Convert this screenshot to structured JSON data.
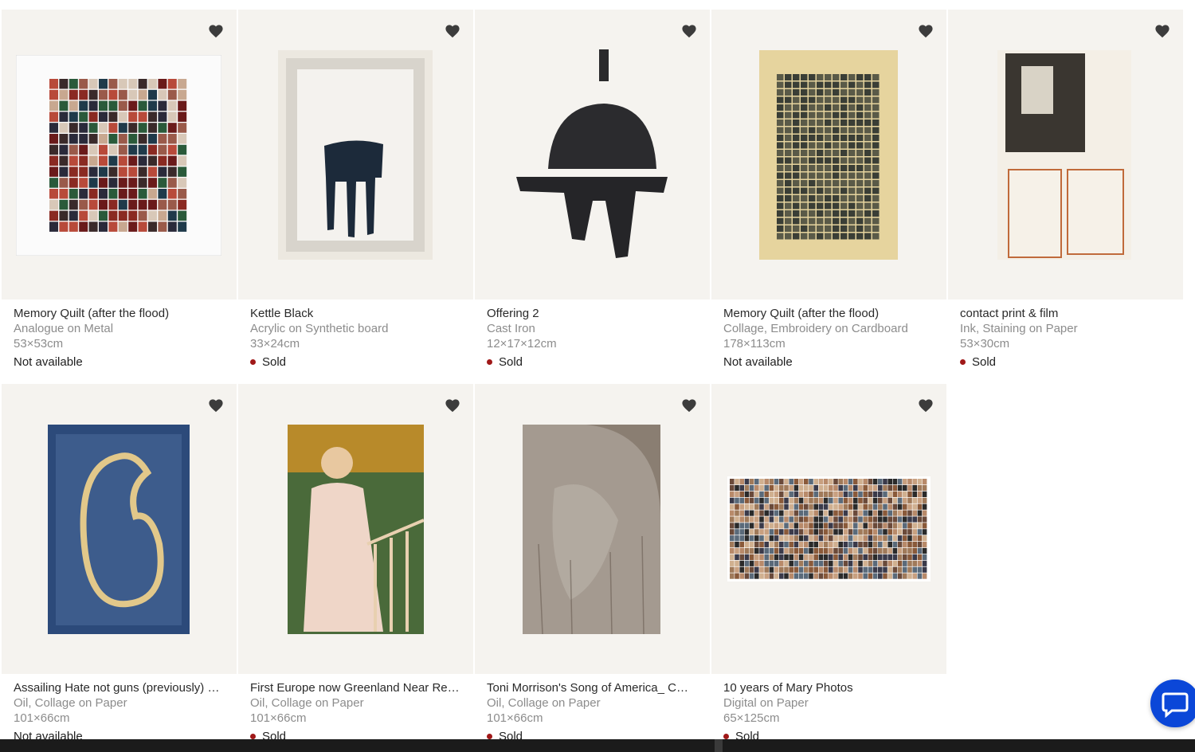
{
  "artworks": [
    {
      "title": "Memory Quilt (after the flood)",
      "medium": "Analogue on Metal",
      "dims": "53×53cm",
      "status": "Not available",
      "sold": false
    },
    {
      "title": "Kettle Black",
      "medium": "Acrylic on Synthetic board",
      "dims": "33×24cm",
      "status": "Sold",
      "sold": true
    },
    {
      "title": "Offering 2",
      "medium": "Cast Iron",
      "dims": "12×17×12cm",
      "status": "Sold",
      "sold": true
    },
    {
      "title": "Memory Quilt (after the flood)",
      "medium": "Collage, Embroidery on Cardboard",
      "dims": "178×113cm",
      "status": "Not available",
      "sold": false
    },
    {
      "title": "contact print & film",
      "medium": "Ink, Staining on Paper",
      "dims": "53×30cm",
      "status": "Sold",
      "sold": true
    },
    {
      "title": "Assailing Hate not guns (previously) …",
      "medium": "Oil, Collage on Paper",
      "dims": "101×66cm",
      "status": "Not available",
      "sold": false
    },
    {
      "title": "First Europe now Greenland Near Re…",
      "medium": "Oil, Collage on Paper",
      "dims": "101×66cm",
      "status": "Sold",
      "sold": true
    },
    {
      "title": "Toni Morrison's Song of America_ C…",
      "medium": "Oil, Collage on Paper",
      "dims": "101×66cm",
      "status": "Sold",
      "sold": true
    },
    {
      "title": "10 years of Mary Photos",
      "medium": "Digital on Paper",
      "dims": "65×125cm",
      "status": "Sold",
      "sold": true
    }
  ],
  "icons": {
    "favorite": "heart-icon",
    "chat": "chat-bubble-icon"
  },
  "colors": {
    "sold_dot": "#a01818",
    "card_bg": "#f5f3ef",
    "chat_button": "#0b47d8"
  }
}
